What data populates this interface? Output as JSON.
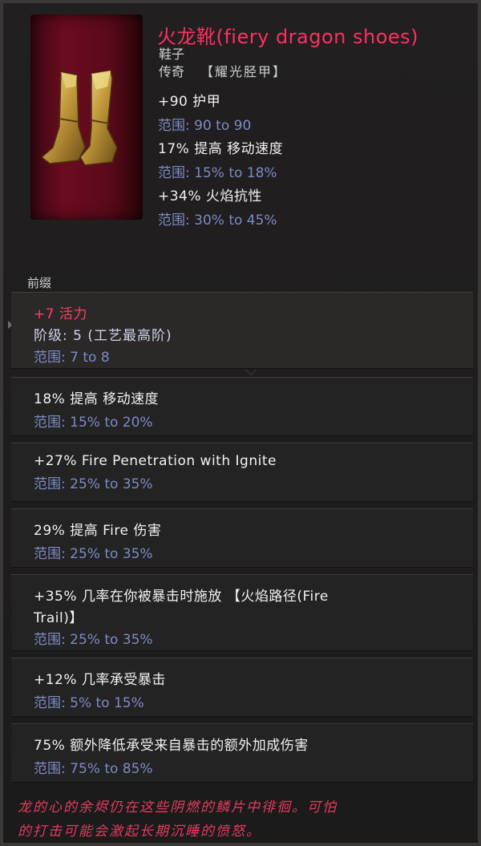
{
  "item": {
    "name": "火龙靴(fiery dragon shoes)",
    "type": "鞋子",
    "rarity": "传奇",
    "base": "【耀光胫甲】",
    "icon": "golden-boots-icon"
  },
  "implicits": [
    {
      "stat": "+90 护甲",
      "range": "范围: 90 to 90"
    },
    {
      "stat": "17% 提高 移动速度",
      "range": "范围: 15% to 18%"
    },
    {
      "stat": "+34% 火焰抗性",
      "range": "范围: 30% to 45%"
    }
  ],
  "section_label": "前缀",
  "affixes": [
    {
      "stat": "+7 活力",
      "tier": "阶级: 5 (工艺最高阶)",
      "range": "范围: 7 to 8"
    },
    {
      "stat": "18% 提高 移动速度",
      "range": "范围: 15% to 20%"
    },
    {
      "stat": "+27% Fire Penetration with Ignite",
      "range": "范围: 25% to 35%"
    },
    {
      "stat": "29% 提高 Fire 伤害",
      "range": "范围: 25% to 35%"
    },
    {
      "stat": "+35% 几率在你被暴击时施放 【火焰路径(Fire",
      "stat2": "Trail)】",
      "range": "范围: 25% to 35%"
    },
    {
      "stat": "+12% 几率承受暴击",
      "range": "范围: 5% to 15%"
    },
    {
      "stat": "75% 额外降低承受来自暴击的额外加成伤害",
      "range": "范围: 75% to 85%"
    }
  ],
  "lore": {
    "line1": "龙的心的余烬仍在这些阴燃的鳞片中徘徊。可怕",
    "line2": "的打击可能会激起长期沉睡的愤怒。"
  },
  "colors": {
    "title": "#ff2f63",
    "range": "#7b8bc6",
    "lore": "#e33a5c",
    "background": "#1b1a1a"
  }
}
